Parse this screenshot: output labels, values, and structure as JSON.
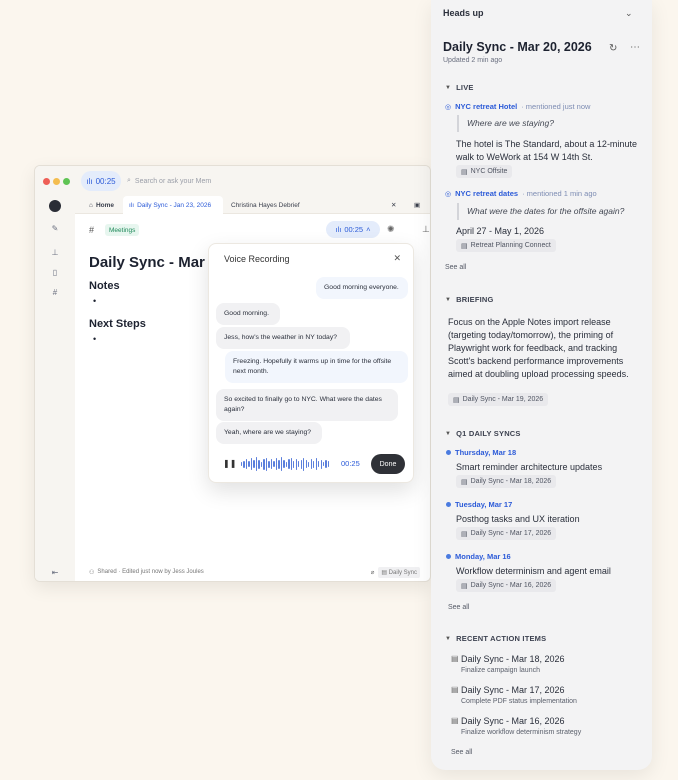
{
  "window": {
    "rec_time": "00:25",
    "search_placeholder": "Search or ask your Mem",
    "tabs": [
      {
        "label": "Home"
      },
      {
        "label": "Daily Sync - Jan 23, 2026"
      },
      {
        "label": "Christina Hayes Debrief"
      }
    ],
    "tag": "Meetings",
    "rec_time_toolbar": "00:25",
    "doc_title": "Daily Sync - Mar 20",
    "notes_heading": "Notes",
    "next_steps_heading": "Next Steps",
    "footer_status": "Shared · Edited just now by Jess Joules",
    "footer_chip": "Daily Sync"
  },
  "voice": {
    "title": "Voice Recording",
    "messages": [
      {
        "text": "Good morning everyone.",
        "me": true
      },
      {
        "text": "Good morning.",
        "me": false
      },
      {
        "text": "Jess, how's the weather in NY today?",
        "me": false
      },
      {
        "text": "Freezing. Hopefully it warms up in time for the offsite next month.",
        "me": true
      },
      {
        "text": "So excited to finally go to NYC. What were the dates again?",
        "me": false
      },
      {
        "text": "Yeah, where are we staying?",
        "me": false
      }
    ],
    "time": "00:25",
    "done_label": "Done"
  },
  "panel": {
    "header": "Heads up",
    "title": "Daily Sync - Mar 20, 2026",
    "updated": "Updated 2 min ago",
    "live": {
      "heading": "LIVE",
      "items": [
        {
          "who": "NYC retreat Hotel",
          "meta": "· mentioned just now",
          "quote": "Where are we staying?",
          "answer": "The hotel is The Standard, about a 12-minute walk to WeWork at 154 W 14th St.",
          "chip": "NYC Offsite"
        },
        {
          "who": "NYC retreat dates",
          "meta": "· mentioned 1 min ago",
          "quote": "What were the dates for the offsite again?",
          "answer": "April 27 - May 1, 2026",
          "chip": "Retreat Planning Connect"
        }
      ],
      "see_all": "See all"
    },
    "briefing": {
      "heading": "BRIEFING",
      "text": "Focus on the Apple Notes import release (targeting today/tomorrow), the priming of Playwright work for feedback, and tracking Scott's backend performance improvements aimed at doubling upload processing speeds.",
      "chip": "Daily Sync - Mar 19, 2026"
    },
    "q1": {
      "heading": "Q1 DAILY SYNCS",
      "items": [
        {
          "day": "Thursday, Mar 18",
          "text": "Smart reminder architecture updates",
          "chip": "Daily Sync - Mar 18, 2026"
        },
        {
          "day": "Tuesday, Mar 17",
          "text": "Posthog tasks and UX iteration",
          "chip": "Daily Sync - Mar 17, 2026"
        },
        {
          "day": "Monday, Mar 16",
          "text": "Workflow determinism and agent email",
          "chip": "Daily Sync - Mar 16, 2026"
        }
      ],
      "see_all": "See all"
    },
    "actions": {
      "heading": "RECENT ACTION ITEMS",
      "items": [
        {
          "title": "Daily Sync - Mar 18, 2026",
          "sub": "Finalize campaign launch"
        },
        {
          "title": "Daily Sync - Mar 17, 2026",
          "sub": "Complete PDF status implementation"
        },
        {
          "title": "Daily Sync - Mar 16, 2026",
          "sub": "Finalize workflow determinism strategy"
        }
      ],
      "see_all": "See all"
    }
  }
}
